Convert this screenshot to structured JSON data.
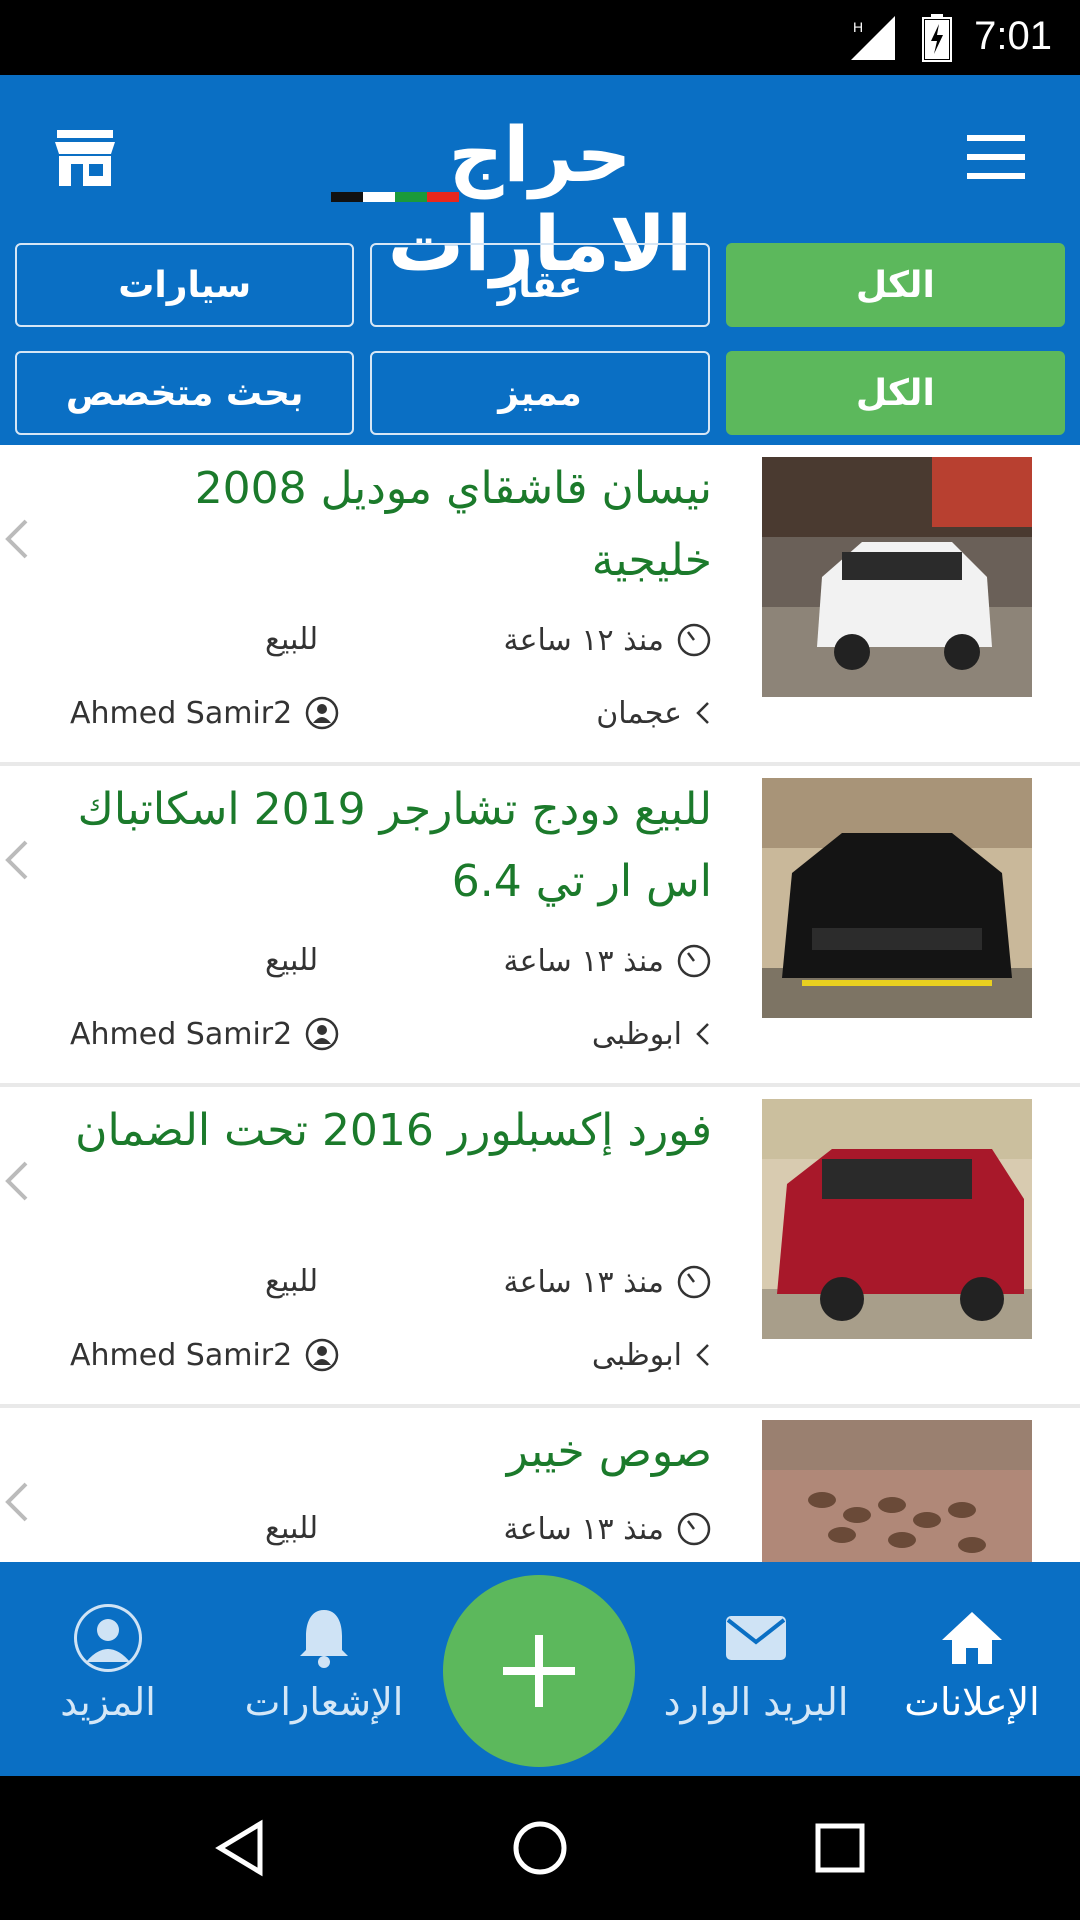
{
  "status_bar": {
    "time": "7:01",
    "network": "H"
  },
  "header": {
    "logo_text": "حراج الامارات",
    "filters_row1": [
      "الكل",
      "عقار",
      "سيارات"
    ],
    "filters_row2": [
      "الكل",
      "مميز",
      "بحث متخصص"
    ],
    "active_filter_index": 0
  },
  "listings": [
    {
      "title": "نيسان قاشقاي موديل 2008 خليجية",
      "time": "منذ ١٢ ساعة",
      "type": "للبيع",
      "city": "عجمان",
      "user": "Ahmed Samir2",
      "image": "car-white-suv"
    },
    {
      "title": "للبيع دودج تشارجر 2019 اسكاتباك اس ار تي 6.4",
      "time": "منذ ١٣ ساعة",
      "type": "للبيع",
      "city": "ابوظبى",
      "user": "Ahmed Samir2",
      "image": "car-black-charger"
    },
    {
      "title": "فورد إكسبلورر 2016 تحت الضمان",
      "time": "منذ ١٣ ساعة",
      "type": "للبيع",
      "city": "ابوظبى",
      "user": "Ahmed Samir2",
      "image": "car-red-explorer"
    },
    {
      "title": "صوص خيبر",
      "time": "منذ ١٣ ساعة",
      "type": "للبيع",
      "city": "",
      "user": "",
      "image": "chicks"
    }
  ],
  "bottom_nav": {
    "items": [
      {
        "label": "الإعلانات",
        "icon": "home-icon",
        "active": true
      },
      {
        "label": "البريد الوارد",
        "icon": "mail-icon",
        "active": false
      },
      {
        "label": "الإشعارات",
        "icon": "bell-icon",
        "active": false
      },
      {
        "label": "المزيد",
        "icon": "profile-icon",
        "active": false
      }
    ],
    "fab_icon": "plus-icon"
  },
  "colors": {
    "primary": "#0a6fc4",
    "accent_green": "#5cb85c",
    "title_green": "#1b7a2b"
  }
}
